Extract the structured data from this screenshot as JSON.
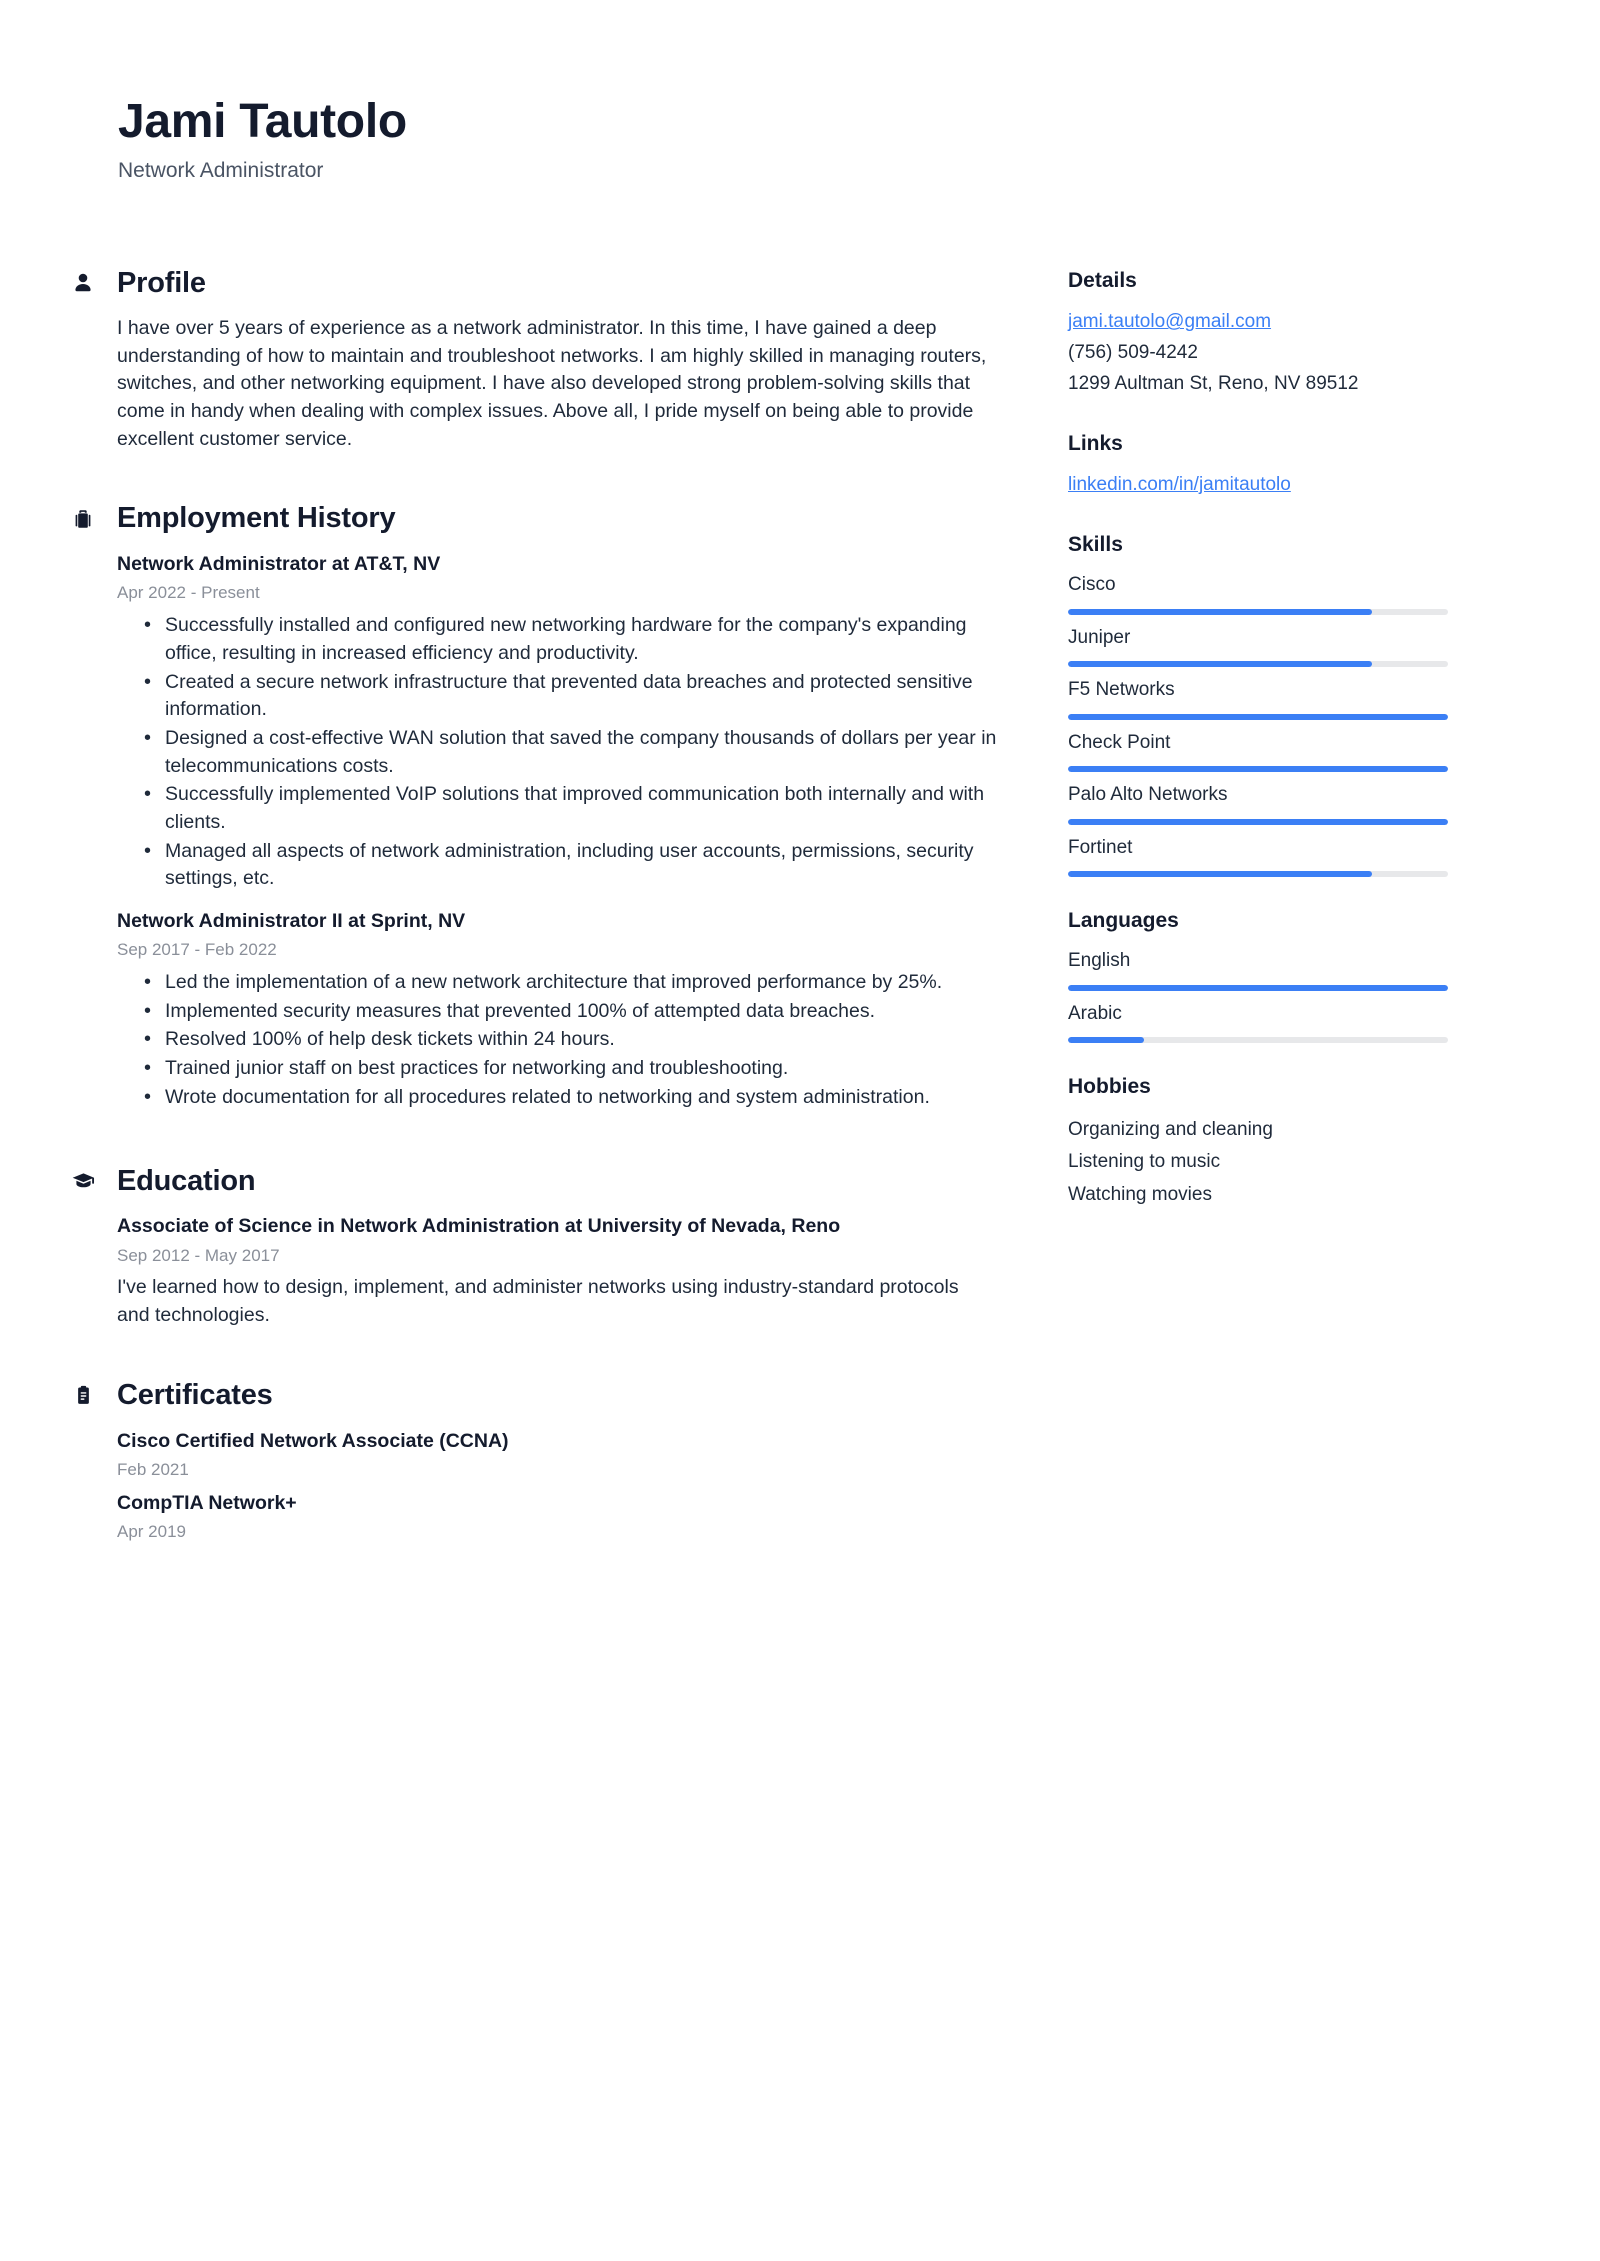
{
  "header": {
    "name": "Jami Tautolo",
    "title": "Network Administrator"
  },
  "colors": {
    "accent": "#3b7ff5",
    "text": "#1f2a3a",
    "heading": "#141b2d",
    "muted": "#8a8f99",
    "track": "#e7e8ea"
  },
  "main": {
    "profile": {
      "icon": "person-icon",
      "heading": "Profile",
      "text": "I have over 5 years of experience as a network administrator. In this time, I have gained a deep understanding of how to maintain and troubleshoot networks. I am highly skilled in managing routers, switches, and other networking equipment. I have also developed strong problem-solving skills that come in handy when dealing with complex issues. Above all, I pride myself on being able to provide excellent customer service."
    },
    "employment": {
      "icon": "briefcase-icon",
      "heading": "Employment History",
      "entries": [
        {
          "title": "Network Administrator at AT&T, NV",
          "date": "Apr 2022 - Present",
          "bullets": [
            "Successfully installed and configured new networking hardware for the company's expanding office, resulting in increased efficiency and productivity.",
            "Created a secure network infrastructure that prevented data breaches and protected sensitive information.",
            "Designed a cost-effective WAN solution that saved the company thousands of dollars per year in telecommunications costs.",
            "Successfully implemented VoIP solutions that improved communication both internally and with clients.",
            "Managed all aspects of network administration, including user accounts, permissions, security settings, etc."
          ]
        },
        {
          "title": "Network Administrator II at Sprint, NV",
          "date": "Sep 2017 - Feb 2022",
          "bullets": [
            "Led the implementation of a new network architecture that improved performance by 25%.",
            "Implemented security measures that prevented 100% of attempted data breaches.",
            "Resolved 100% of help desk tickets within 24 hours.",
            "Trained junior staff on best practices for networking and troubleshooting.",
            "Wrote documentation for all procedures related to networking and system administration."
          ]
        }
      ]
    },
    "education": {
      "icon": "graduation-cap-icon",
      "heading": "Education",
      "entries": [
        {
          "title": "Associate of Science in Network Administration at University of Nevada, Reno",
          "date": "Sep 2012 - May 2017",
          "description": "I've learned how to design, implement, and administer networks using industry-standard protocols and technologies."
        }
      ]
    },
    "certificates": {
      "icon": "clipboard-icon",
      "heading": "Certificates",
      "entries": [
        {
          "title": "Cisco Certified Network Associate (CCNA)",
          "date": "Feb 2021"
        },
        {
          "title": "CompTIA Network+",
          "date": "Apr 2019"
        }
      ]
    }
  },
  "sidebar": {
    "details": {
      "heading": "Details",
      "email": "jami.tautolo@gmail.com",
      "phone": "(756) 509-4242",
      "address": "1299 Aultman St, Reno, NV 89512"
    },
    "links": {
      "heading": "Links",
      "items": [
        {
          "label": "linkedin.com/in/jamitautolo"
        }
      ]
    },
    "skills": {
      "heading": "Skills",
      "items": [
        {
          "label": "Cisco",
          "level": 80
        },
        {
          "label": "Juniper",
          "level": 80
        },
        {
          "label": "F5 Networks",
          "level": 100
        },
        {
          "label": "Check Point",
          "level": 100
        },
        {
          "label": "Palo Alto Networks",
          "level": 100
        },
        {
          "label": "Fortinet",
          "level": 80
        }
      ]
    },
    "languages": {
      "heading": "Languages",
      "items": [
        {
          "label": "English",
          "level": 100
        },
        {
          "label": "Arabic",
          "level": 20
        }
      ]
    },
    "hobbies": {
      "heading": "Hobbies",
      "items": [
        {
          "label": "Organizing and cleaning"
        },
        {
          "label": "Listening to music"
        },
        {
          "label": "Watching movies"
        }
      ]
    }
  }
}
